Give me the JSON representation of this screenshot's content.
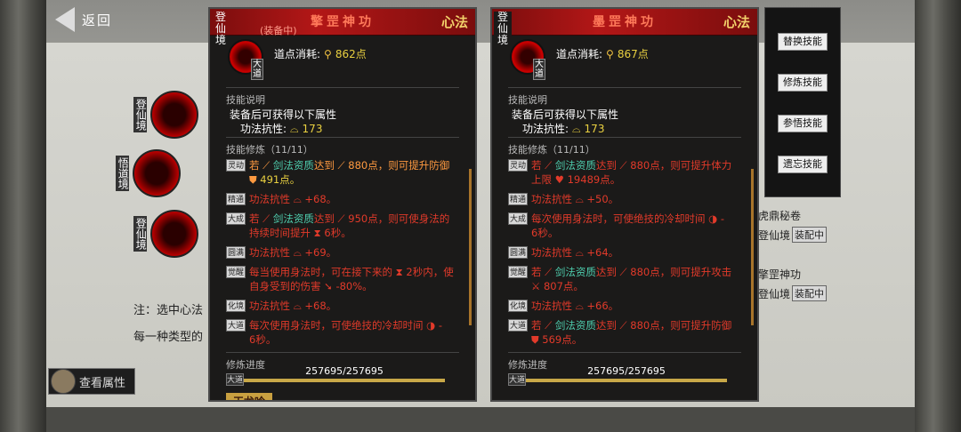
{
  "nav": {
    "back_label": "返回"
  },
  "realms": [
    {
      "label": "登仙境"
    },
    {
      "label": "悟道境"
    },
    {
      "label": "登仙境"
    }
  ],
  "notes": {
    "line1": "注：选中心法",
    "line2": "每一种类型的"
  },
  "view_attr": {
    "label": "查看属性"
  },
  "panels": [
    {
      "realm": "登仙境",
      "title": "擎罡神功",
      "equipped": "(装备中)",
      "xinfa": "心法",
      "tier_badge": "大道",
      "cost_label": "道点消耗:",
      "cost_value": "862点",
      "desc_header": "技能说明",
      "desc_text": "装备后可获得以下属性",
      "stat_label": "功法抗性:",
      "stat_value": "173",
      "train_header": "技能修炼（11/11）",
      "tiers": [
        {
          "tag": "灵动",
          "pre": "若",
          "mid": "剑法资质",
          "post": "达到",
          "n": "880点，则可提升防御",
          "tail": "491点。",
          "orange": true
        },
        {
          "tag": "精通",
          "text": "功法抗性 ⌓ +68。"
        },
        {
          "tag": "大成",
          "pre": "若",
          "mid": "剑法资质",
          "post": "达到",
          "n": "950点，则可使身法的",
          "tail": "持续时间提升 ⧗ 6秒。"
        },
        {
          "tag": "圆满",
          "text": "功法抗性 ⌓ +69。"
        },
        {
          "tag": "觉醒",
          "text": "每当使用身法时，可在接下来的 ⧗ 2秒内，使",
          "tail": "自身受到的伤害 ➘ -80%。"
        },
        {
          "tag": "化境",
          "text": "功法抗性 ⌓ +68。"
        },
        {
          "tag": "大道",
          "text": "每次使用身法时，可使绝技的冷却时间 ◑ -",
          "tail": "6秒。"
        }
      ],
      "progress_label": "修炼进度",
      "progress_tag": "大道",
      "progress_value": "257695/257695",
      "progress_fraction": 1.0,
      "item_label": "玉龙吟"
    },
    {
      "realm": "登仙境",
      "title": "墨罡神功",
      "xinfa": "心法",
      "tier_badge": "大道",
      "cost_label": "道点消耗:",
      "cost_value": "867点",
      "desc_header": "技能说明",
      "desc_text": "装备后可获得以下属性",
      "stat_label": "功法抗性:",
      "stat_value": "173",
      "train_header": "技能修炼（11/11）",
      "tiers": [
        {
          "tag": "灵动",
          "pre": "若",
          "mid": "剑法资质",
          "post": "达到",
          "n": "880点，则可提升体力",
          "tail": "上限 ♥ 19489点。"
        },
        {
          "tag": "精通",
          "text": "功法抗性 ⌓ +50。"
        },
        {
          "tag": "大成",
          "text": "每次使用身法时，可使绝技的冷却时间 ◑ -",
          "tail": "6秒。"
        },
        {
          "tag": "圆满",
          "text": "功法抗性 ⌓ +64。"
        },
        {
          "tag": "觉醒",
          "pre": "若",
          "mid": "剑法资质",
          "post": "达到",
          "n": "880点，则可提升攻击",
          "tail": "⚔ 807点。"
        },
        {
          "tag": "化境",
          "text": "功法抗性 ⌓ +66。"
        },
        {
          "tag": "大道",
          "pre": "若",
          "mid": "剑法资质",
          "post": "达到",
          "n": "880点，则可提升防御",
          "tail": "569点。"
        }
      ],
      "progress_label": "修炼进度",
      "progress_tag": "大道",
      "progress_value": "257695/257695",
      "progress_fraction": 1.0
    }
  ],
  "actions": [
    "替换技能",
    "修炼技能",
    "参悟技能",
    "遗忘技能"
  ],
  "side_list": [
    {
      "name": "虎鼎秘卷",
      "realm": "登仙境",
      "status": "装配中"
    },
    {
      "name": "擎罡神功",
      "realm": "登仙境",
      "status": "装配中"
    }
  ]
}
